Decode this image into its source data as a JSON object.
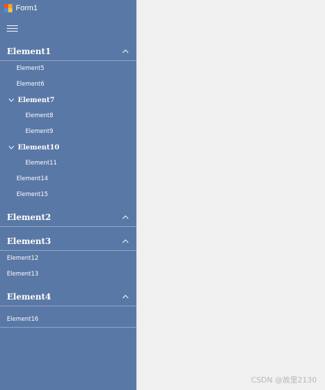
{
  "window": {
    "title": "Form1"
  },
  "nav": {
    "groups": [
      {
        "title": "Element1",
        "items": [
          {
            "label": "Element5"
          },
          {
            "label": "Element6"
          },
          {
            "label": "Element7",
            "children": [
              {
                "label": "Element8"
              },
              {
                "label": "Element9"
              }
            ]
          },
          {
            "label": "Element10",
            "children": [
              {
                "label": "Element11"
              }
            ]
          },
          {
            "label": "Element14"
          },
          {
            "label": "Element15"
          }
        ]
      },
      {
        "title": "Element2",
        "items": []
      },
      {
        "title": "Element3",
        "items": [
          {
            "label": "Element12"
          },
          {
            "label": "Element13"
          }
        ]
      },
      {
        "title": "Element4",
        "items": [
          {
            "label": "Element16"
          }
        ]
      }
    ]
  },
  "watermark": "CSDN @故里2130",
  "colors": {
    "sidebar": "#5a78a6",
    "content": "#f0f0f0",
    "text": "#ffffff"
  }
}
